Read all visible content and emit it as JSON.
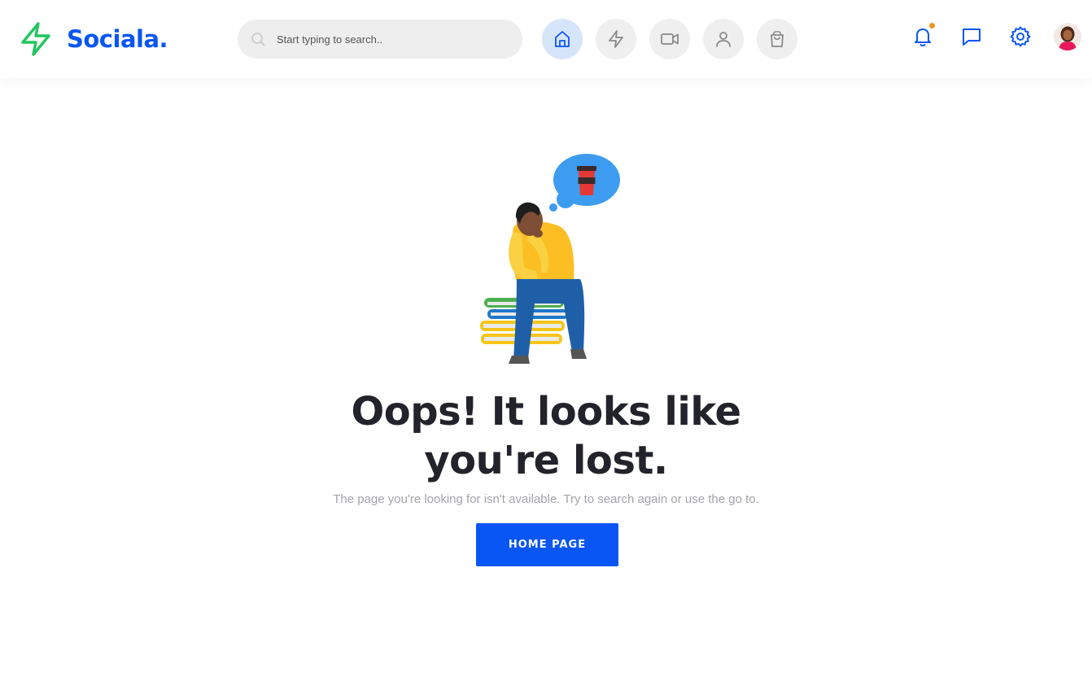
{
  "header": {
    "brand_name": "Sociala.",
    "search": {
      "placeholder": "Start typing to search.."
    },
    "nav": [
      {
        "icon": "home-icon",
        "active": true
      },
      {
        "icon": "lightning-icon",
        "active": false
      },
      {
        "icon": "video-icon",
        "active": false
      },
      {
        "icon": "user-icon",
        "active": false
      },
      {
        "icon": "shopping-bag-icon",
        "active": false
      }
    ],
    "actions": [
      "bell-icon",
      "message-icon",
      "settings-icon"
    ],
    "notification_dot": true
  },
  "main": {
    "headline_line1": "Oops! It looks like",
    "headline_line2": "you're lost.",
    "subtext": "The page you're looking for isn't available. Try to search again or use the go to.",
    "button_label": "HOME PAGE"
  },
  "colors": {
    "brand": "#0a56f5",
    "logo_bolt": "#22c55e",
    "notification": "#f0922b",
    "headline": "#23232b",
    "subtext": "#a3a3ac"
  }
}
